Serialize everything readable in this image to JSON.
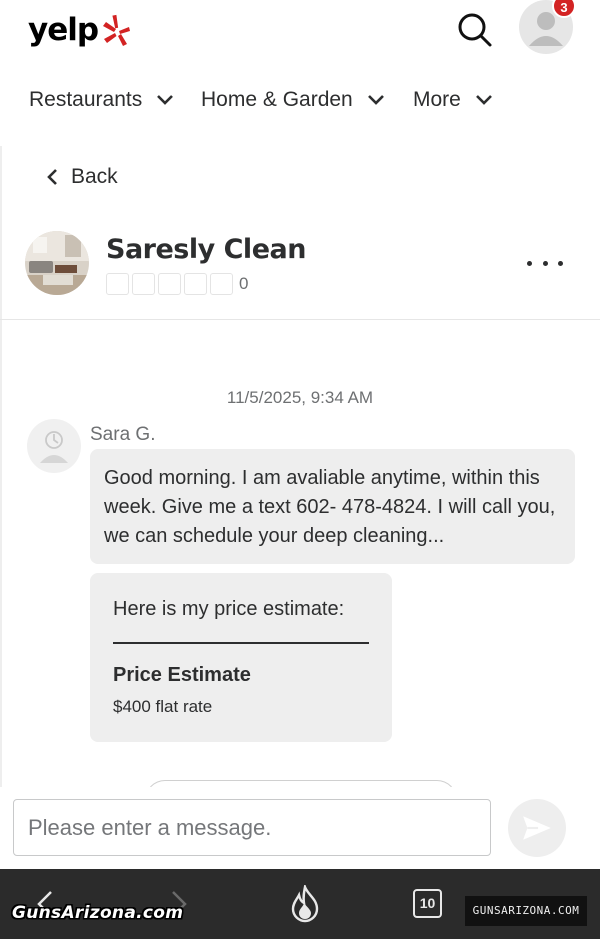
{
  "header": {
    "logo_text": "yelp",
    "logo_burst_icon": "yelp-burst-icon",
    "search_icon": "search-icon",
    "avatar_icon": "user-avatar-icon",
    "notification_count": "3",
    "colors": {
      "brand_red": "#d32323",
      "text_dark": "#2d2e2f"
    }
  },
  "category_nav": [
    {
      "label": "Restaurants",
      "icon": "chevron-down-icon"
    },
    {
      "label": "Home & Garden",
      "icon": "chevron-down-icon"
    },
    {
      "label": "More",
      "icon": "chevron-down-icon"
    }
  ],
  "conversation_header": {
    "back_label": "Back",
    "business_name": "Saresly Clean",
    "rating_stars": 0,
    "review_count": "0",
    "more_icon": "more-horizontal-icon"
  },
  "messages": {
    "timestamp": "11/5/2025, 9:34 AM",
    "sender_name": "Sara G.",
    "message_text": "Good morning. I am avaliable anytime,  within this week. Give me a text 602- 478-4824. I will call you,  we can schedule your deep cleaning...",
    "estimate": {
      "intro": "Here is my price estimate:",
      "title": "Price Estimate",
      "rate": "$400 flat rate"
    }
  },
  "composer": {
    "placeholder": "Please enter a message.",
    "send_icon": "send-icon"
  },
  "browser_bar": {
    "tab_count": "10",
    "icons": [
      "back-arrow-icon",
      "forward-arrow-icon",
      "flame-icon",
      "tabs-icon",
      "more-dots-icon"
    ]
  },
  "watermarks": {
    "left": "GunsArizona.com",
    "right": "GUNSARIZONA.COM"
  }
}
